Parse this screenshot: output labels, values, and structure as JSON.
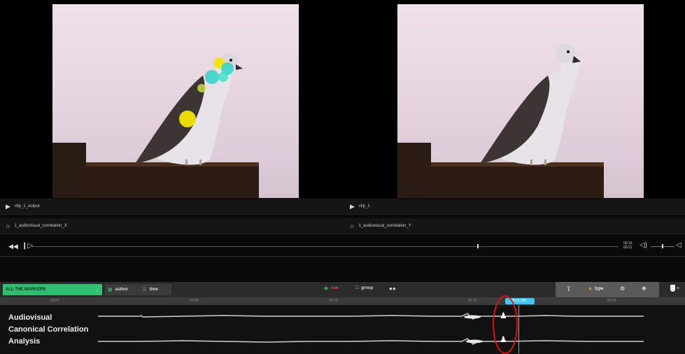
{
  "videos": {
    "left": {
      "name": "clip_1_output",
      "audio": "1_audiovisual_correlation_X"
    },
    "right": {
      "name": "clip_1",
      "audio": "1_audiovisual_correlation_Y"
    }
  },
  "player": {
    "rewind_icon": "rewind-icon",
    "play_icon": "play-icon",
    "time_current": "00:16",
    "time_total": "00:21",
    "progress": 0.76,
    "volume_icon": "speaker-icon"
  },
  "toolbar": {
    "markers_select": "ALL THE MARKERS",
    "author_label": "author",
    "time_label": "time",
    "cue_label": "cue",
    "group_label": "group",
    "binoculars_icon": "binoculars-icon",
    "text_icon": "T",
    "type_label": "type",
    "settings_icon": "gear-icon",
    "move_icon": "move-icon",
    "add_label": "+"
  },
  "timeline": {
    "ticks": [
      "00:00",
      "00:05",
      "00:10",
      "00:15",
      "00:20"
    ],
    "playhead_label": "00:16.280",
    "track_title_lines": [
      "Audiovisual",
      "Canonical Correlation",
      "Analysis"
    ]
  },
  "colors": {
    "accent_green": "#2fbf71",
    "playhead_blue": "#3ec6f0",
    "annotation_red": "#e01010",
    "cue_red": "#ff3b3b",
    "heatmap_yellow": "#f2e600",
    "heatmap_cyan": "#2fd3c8"
  }
}
